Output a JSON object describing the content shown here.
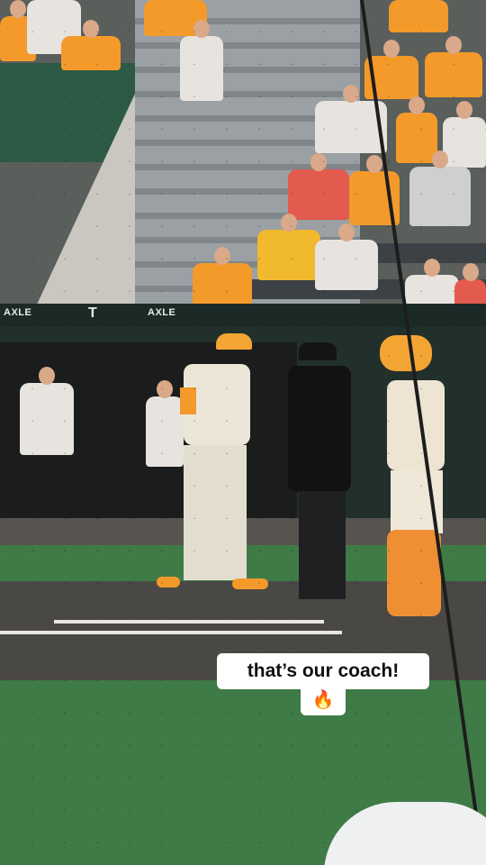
{
  "photo": {
    "subject": "baseball-coach-arguing-with-umpire"
  },
  "signage": {
    "sponsor_left": "AXLE",
    "logo_center": "T",
    "sponsor_right": "AXLE"
  },
  "caption": {
    "text": "that’s our coach!",
    "emoji": "🔥"
  },
  "colors": {
    "team_orange": "#f39a2a",
    "uniform_cream": "#ece6d9",
    "field_green": "#3f7b46"
  }
}
